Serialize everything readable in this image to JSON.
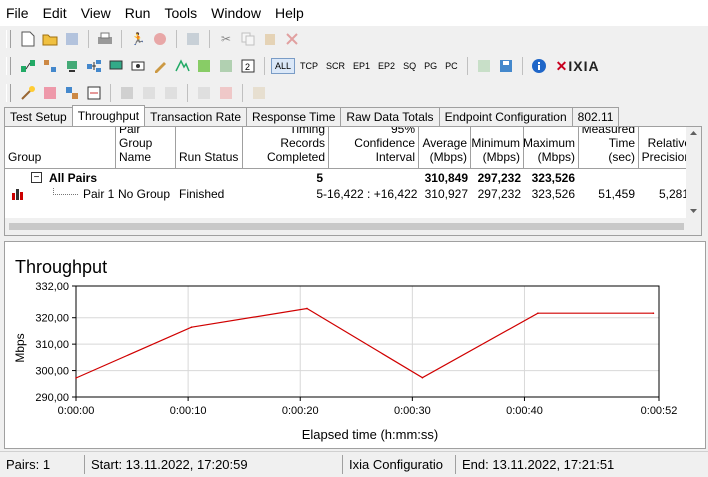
{
  "menu": [
    "File",
    "Edit",
    "View",
    "Run",
    "Tools",
    "Window",
    "Help"
  ],
  "toolbar": {
    "filters": [
      "ALL",
      "TCP",
      "SCR",
      "EP1",
      "EP2",
      "SQ",
      "PG",
      "PC"
    ],
    "brand": "IXIA"
  },
  "tabs": [
    "Test Setup",
    "Throughput",
    "Transaction Rate",
    "Response Time",
    "Raw Data Totals",
    "Endpoint Configuration",
    "802.11"
  ],
  "grid": {
    "headers": [
      "Group",
      "Pair Group Name",
      "Run Status",
      "Timing Records Completed",
      "95% Confidence Interval",
      "Average (Mbps)",
      "Minimum (Mbps)",
      "Maximum (Mbps)",
      "Measured Time (sec)",
      "Relative Precision"
    ],
    "all_pairs": {
      "label": "All Pairs",
      "records": "5",
      "average": "310,849",
      "minimum": "297,232",
      "maximum": "323,526"
    },
    "pair1": {
      "pair": "Pair 1",
      "group": "No Group",
      "status": "Finished",
      "records": "5",
      "confidence": "-16,422 : +16,422",
      "average": "310,927",
      "minimum": "297,232",
      "maximum": "323,526",
      "time": "51,459",
      "precision": "5,281"
    }
  },
  "chart_data": {
    "type": "line",
    "title": "Throughput",
    "xlabel": "Elapsed time (h:mm:ss)",
    "ylabel": "Mbps",
    "ylim": [
      290,
      332
    ],
    "y_ticks": [
      "290,00",
      "300,00",
      "310,00",
      "320,00",
      "332,00"
    ],
    "x_ticks": [
      "0:00:00",
      "0:00:10",
      "0:00:20",
      "0:00:30",
      "0:00:40",
      "0:00:52"
    ],
    "x_tick_seconds": [
      0,
      10,
      20,
      30,
      40,
      52
    ],
    "xlim": [
      0,
      52
    ],
    "series": [
      {
        "color": "#d00000",
        "x": [
          0,
          10.3,
          20.6,
          30.9,
          41.2,
          51.5
        ],
        "y": [
          297.2,
          316.4,
          323.5,
          297.3,
          321.7,
          321.7
        ]
      }
    ],
    "grid": true
  },
  "status": {
    "pairs": "Pairs: 1",
    "start": "Start: 13.11.2022, 17:20:59",
    "config": "Ixia Configuratio",
    "end": "End: 13.11.2022, 17:21:51"
  }
}
